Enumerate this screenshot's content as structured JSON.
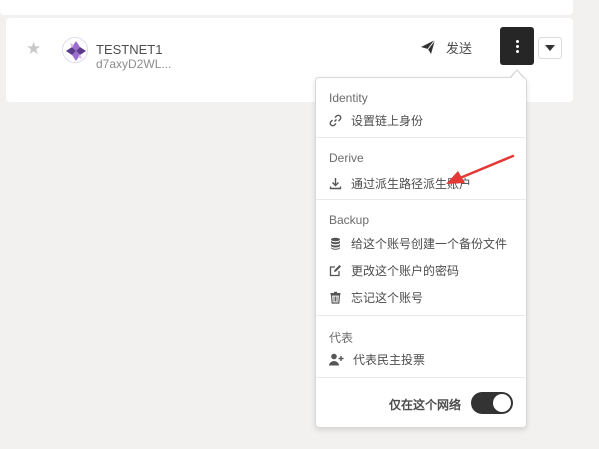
{
  "account": {
    "name": "TESTNET1",
    "address": "d7axyD2WL..."
  },
  "actions": {
    "send_label": "发送"
  },
  "menu": {
    "identity": {
      "header": "Identity",
      "items": [
        {
          "label": "设置链上身份",
          "icon": "link-icon"
        }
      ]
    },
    "derive": {
      "header": "Derive",
      "items": [
        {
          "label": "通过派生路径派生账户",
          "icon": "download-icon"
        }
      ]
    },
    "backup": {
      "header": "Backup",
      "items": [
        {
          "label": "给这个账号创建一个备份文件",
          "icon": "database-icon"
        },
        {
          "label": "更改这个账户的密码",
          "icon": "edit-icon"
        },
        {
          "label": "忘记这个账号",
          "icon": "trash-icon"
        }
      ]
    },
    "proxy": {
      "header": "代表",
      "items": [
        {
          "label": "代表民主投票",
          "icon": "user-plus-icon"
        }
      ]
    },
    "network_toggle": {
      "label": "仅在这个网络",
      "on": true
    }
  },
  "colors": {
    "accent_dark": "#262626",
    "annotation_red": "#e53935",
    "background": "#f3f1ef"
  }
}
